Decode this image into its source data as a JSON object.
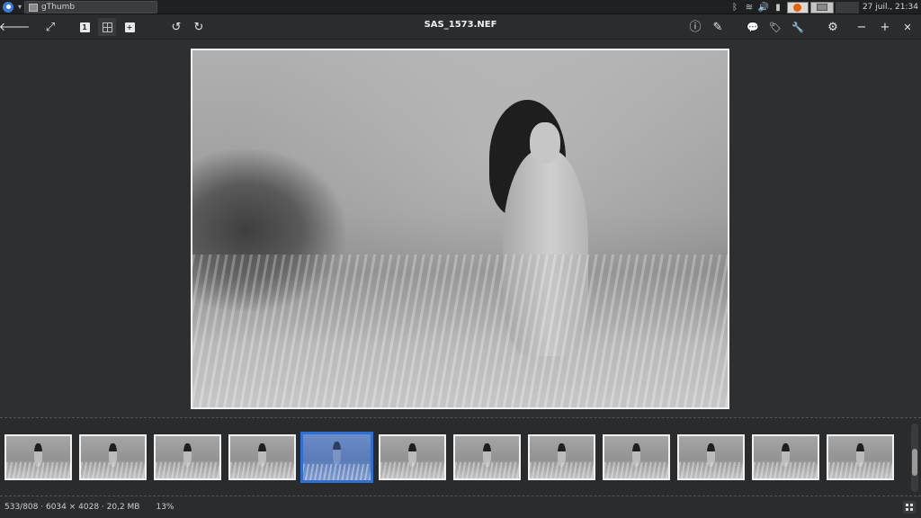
{
  "taskbar": {
    "window_label": "gThumb",
    "clock": "27 juil., 21:34",
    "tray_icons": [
      "bluetooth-icon",
      "wifi-icon",
      "volume-icon",
      "battery-icon"
    ],
    "apps": [
      "firefox-icon",
      "gthumb-icon"
    ]
  },
  "toolbar": {
    "title": "SAS_1573.NEF",
    "actual_size_glyph": "1",
    "zoom_glyph": "+",
    "left_icons": [
      "back-arrow-icon",
      "fullscreen-icon",
      "actual-size-icon",
      "fit-grid-icon",
      "zoom-in-icon",
      "rotate-left-icon",
      "rotate-right-icon"
    ],
    "right_icons": [
      "info-icon",
      "edit-brush-icon",
      "comment-icon",
      "tags-icon",
      "tools-icon",
      "settings-icon",
      "minimize-icon",
      "maximize-icon",
      "close-icon"
    ],
    "back_glyph": "🡐",
    "fullscreen_glyph": "⤢",
    "rotate_left_glyph": "↺",
    "rotate_right_glyph": "↻",
    "info_glyph": "ⓘ",
    "brush_glyph": "✎",
    "comment_glyph": "💬",
    "tags_glyph": "🏷",
    "tools_glyph": "🔧",
    "settings_glyph": "⚙",
    "minimize_glyph": "−",
    "maximize_glyph": "+",
    "close_glyph": "✕"
  },
  "thumbnails": {
    "count": 12,
    "selected_index": 4
  },
  "status": {
    "info": "533/808 · 6034 × 4028 · 20,2 MB",
    "zoom": "13%"
  },
  "colors": {
    "selection": "#2f6fcf",
    "background": "#2e2f30"
  }
}
